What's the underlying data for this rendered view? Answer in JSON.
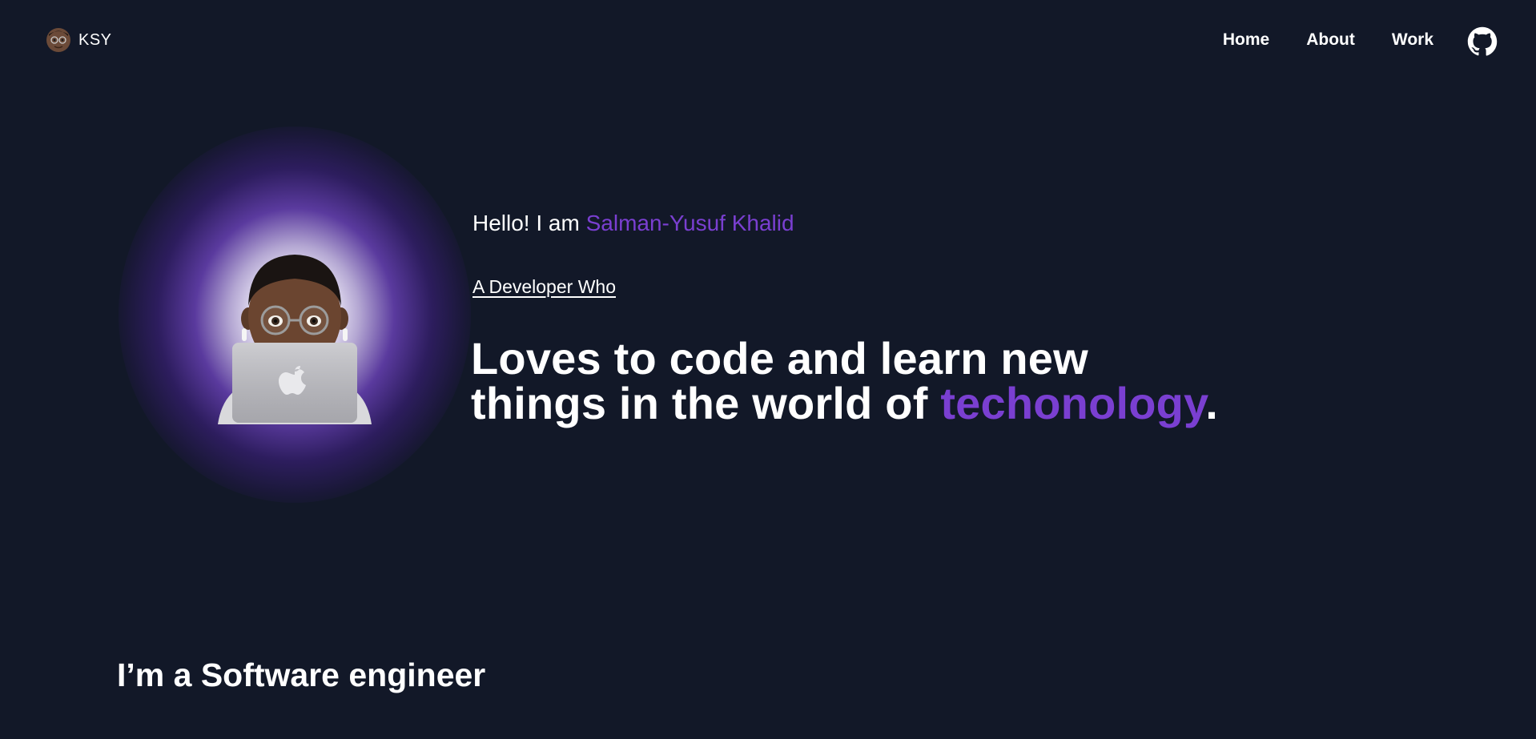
{
  "header": {
    "brand_text": "KSY",
    "brand_icon": "memoji-avatar-icon",
    "nav": [
      {
        "label": "Home"
      },
      {
        "label": "About"
      },
      {
        "label": "Work"
      }
    ],
    "github_icon": "github-icon"
  },
  "hero": {
    "greeting_prefix": "Hello! I am ",
    "name": "Salman-Yusuf Khalid",
    "subtitle": "A Developer Who",
    "headline_line1": "Loves to code and learn new",
    "headline_line2_prefix": "things in the world of ",
    "headline_accent": "techonology",
    "headline_suffix": ".",
    "image_icon": "memoji-laptop-icon"
  },
  "section": {
    "title": "I’m a Software engineer"
  },
  "colors": {
    "background": "#121828",
    "accent": "#7a3fd1",
    "text": "#ffffff"
  }
}
